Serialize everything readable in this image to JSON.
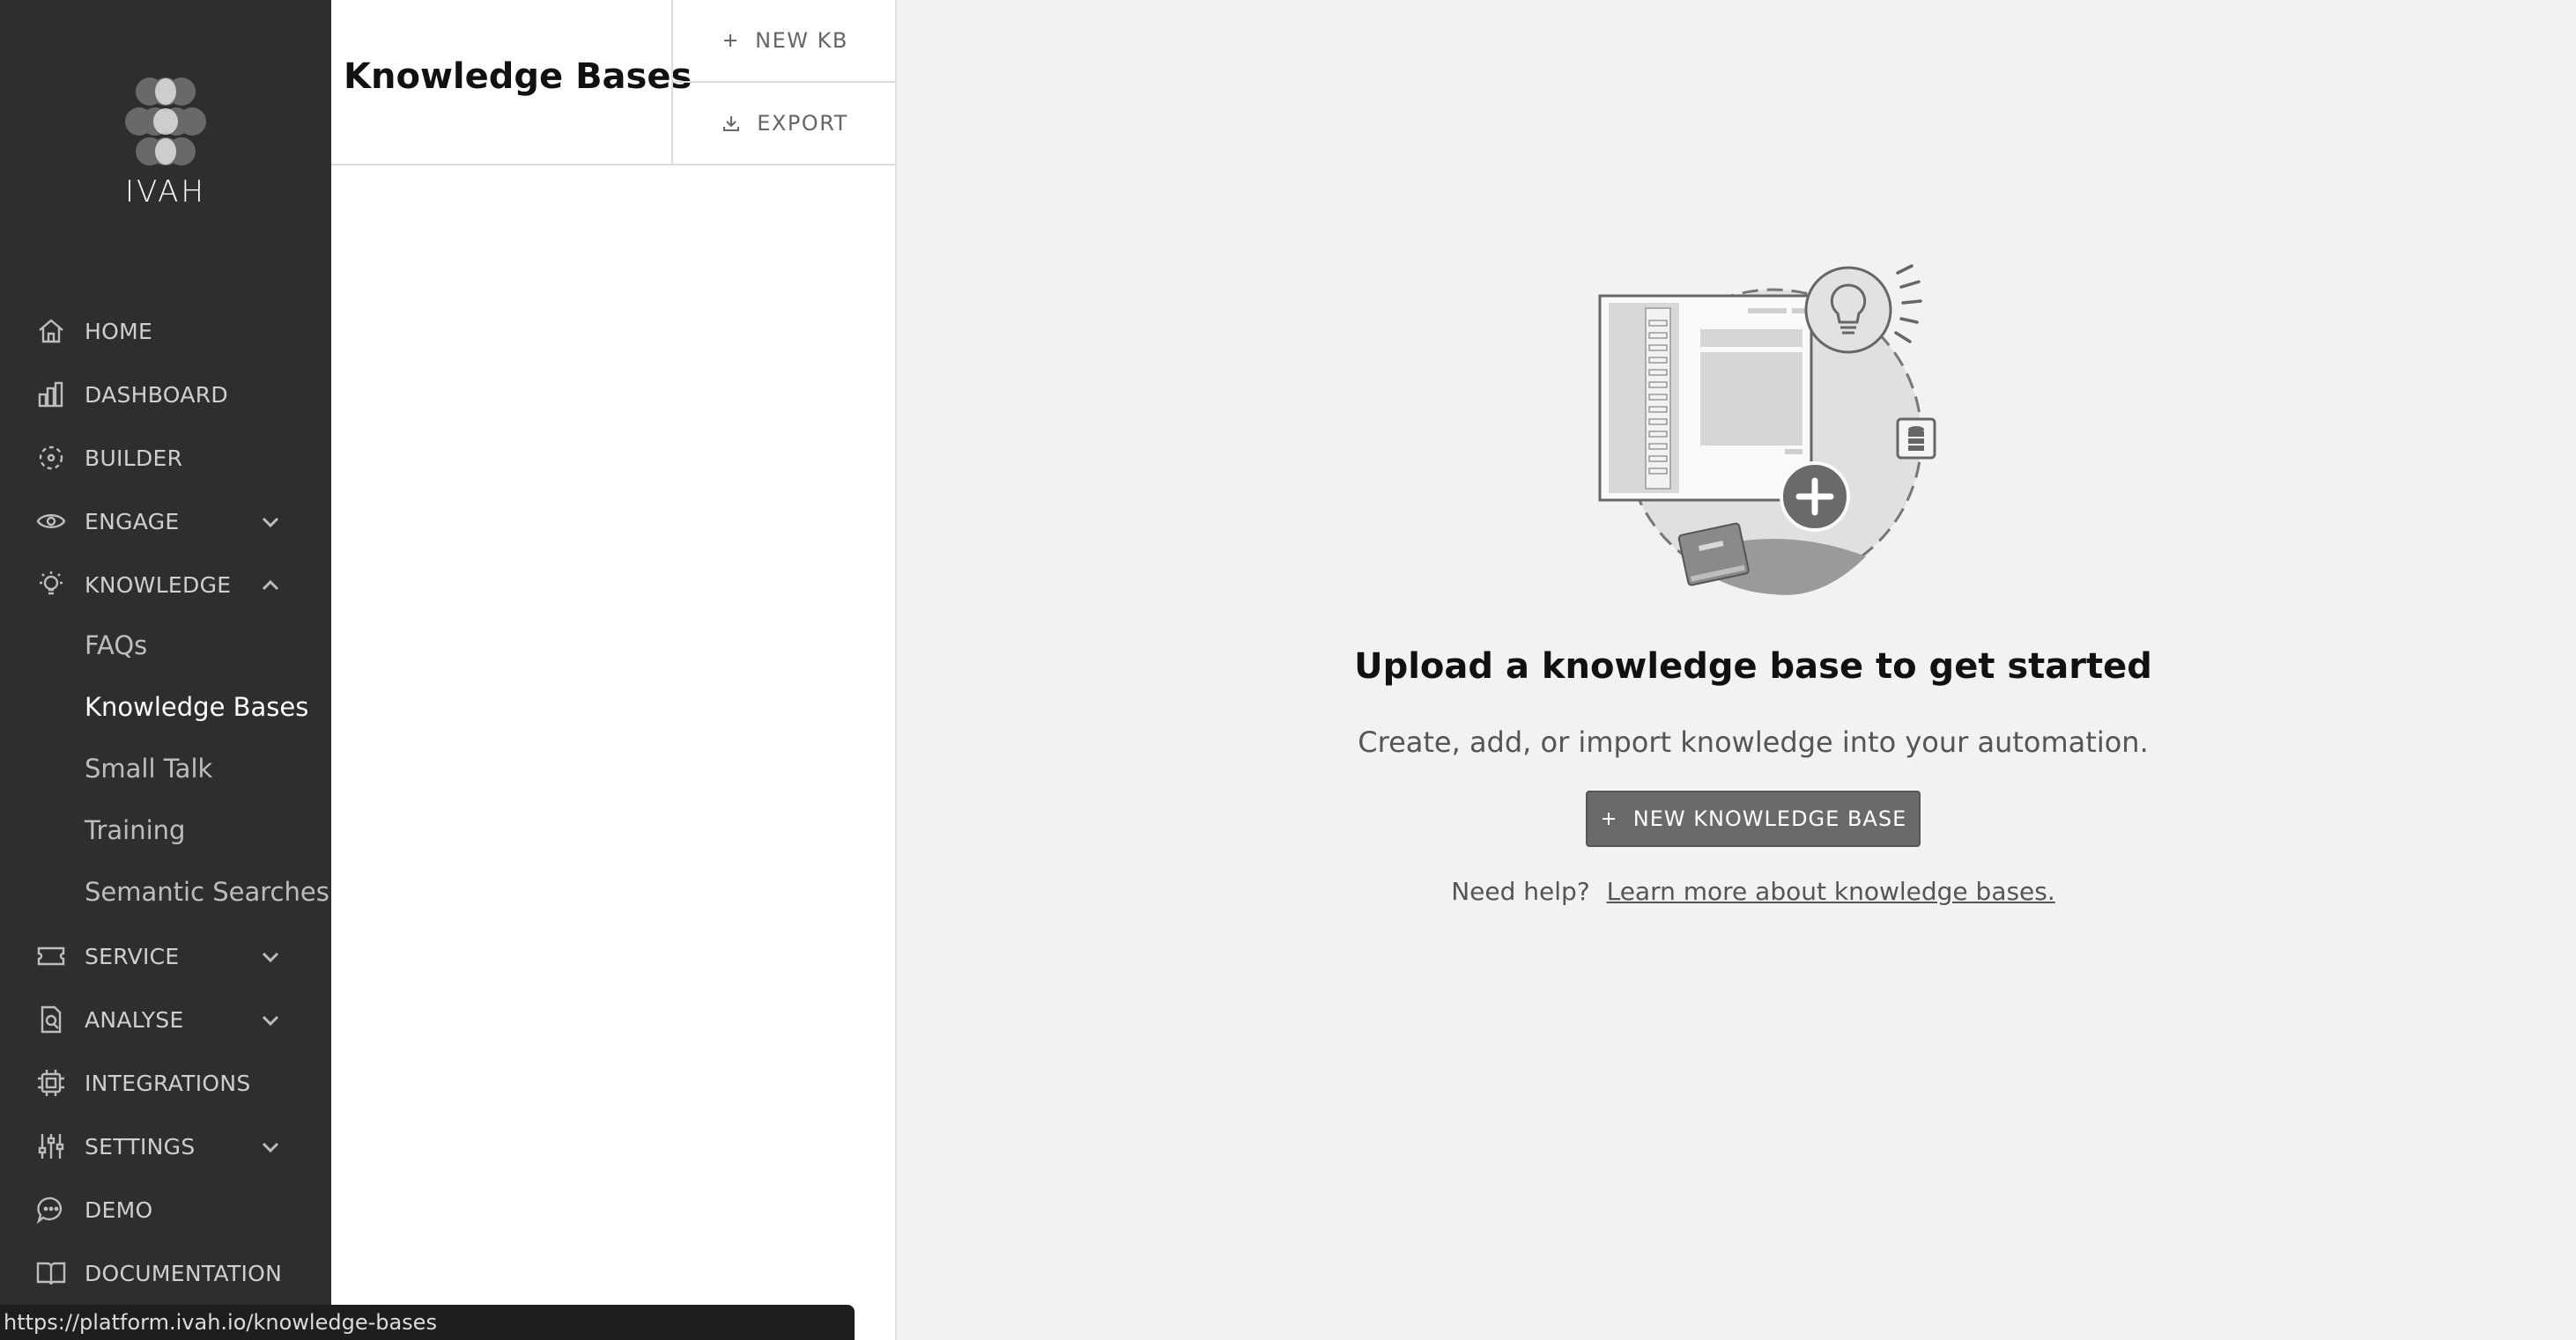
{
  "brand": {
    "name": "IVAH"
  },
  "sidebar": {
    "items": [
      {
        "label": "HOME",
        "icon": "home-icon"
      },
      {
        "label": "DASHBOARD",
        "icon": "bar-chart-icon"
      },
      {
        "label": "BUILDER",
        "icon": "builder-icon"
      },
      {
        "label": "ENGAGE",
        "icon": "eye-icon",
        "expandable": true
      },
      {
        "label": "KNOWLEDGE",
        "icon": "lightbulb-icon",
        "expanded": true
      },
      {
        "label": "SERVICE",
        "icon": "ticket-icon",
        "expandable": true
      },
      {
        "label": "ANALYSE",
        "icon": "analyse-icon",
        "expandable": true
      },
      {
        "label": "INTEGRATIONS",
        "icon": "chip-icon"
      },
      {
        "label": "SETTINGS",
        "icon": "sliders-icon",
        "expandable": true
      },
      {
        "label": "DEMO",
        "icon": "chat-icon"
      },
      {
        "label": "DOCUMENTATION",
        "icon": "book-icon"
      }
    ],
    "knowledge_sub": [
      "FAQs",
      "Knowledge Bases",
      "Small Talk",
      "Training",
      "Semantic Searches"
    ],
    "active_sub": "Knowledge Bases"
  },
  "panel": {
    "title": "Knowledge Bases",
    "new_kb_label": "NEW KB",
    "export_label": "EXPORT"
  },
  "empty_state": {
    "title": "Upload a knowledge base to get started",
    "subtitle": "Create, add, or import knowledge into your automation.",
    "button_label": "NEW KNOWLEDGE BASE",
    "help_prefix": "Need help?",
    "help_link": "Learn more about knowledge bases."
  },
  "status_bar": {
    "url": "https://platform.ivah.io/knowledge-bases"
  },
  "colors": {
    "sidebar_bg": "#2e2e2e",
    "button_bg": "#6a6a6a",
    "page_bg": "#f2f2f2"
  }
}
